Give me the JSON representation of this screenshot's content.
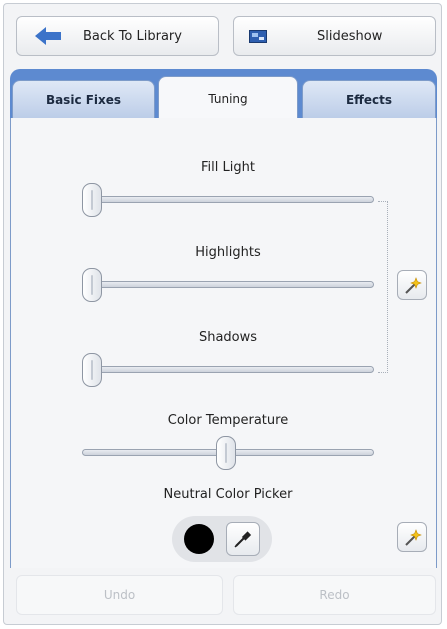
{
  "toolbar": {
    "back_label": "Back To Library",
    "slideshow_label": "Slideshow"
  },
  "tabs": [
    {
      "label": "Basic Fixes",
      "active": false
    },
    {
      "label": "Tuning",
      "active": true
    },
    {
      "label": "Effects",
      "active": false
    }
  ],
  "tuning": {
    "fill_light": {
      "label": "Fill Light",
      "value": 0.0
    },
    "highlights": {
      "label": "Highlights",
      "value": 0.0
    },
    "shadows": {
      "label": "Shadows",
      "value": 0.0
    },
    "color_temperature": {
      "label": "Color Temperature",
      "value": 0.5
    },
    "neutral_color_picker": {
      "label": "Neutral Color Picker"
    }
  },
  "footer": {
    "undo_label": "Undo",
    "redo_label": "Redo"
  },
  "colors": {
    "tab_blue": "#5d8ad0",
    "swatch": "#000000"
  },
  "icons": [
    "arrow-left-icon",
    "slideshow-icon",
    "magic-wand-icon",
    "eyedropper-icon"
  ]
}
